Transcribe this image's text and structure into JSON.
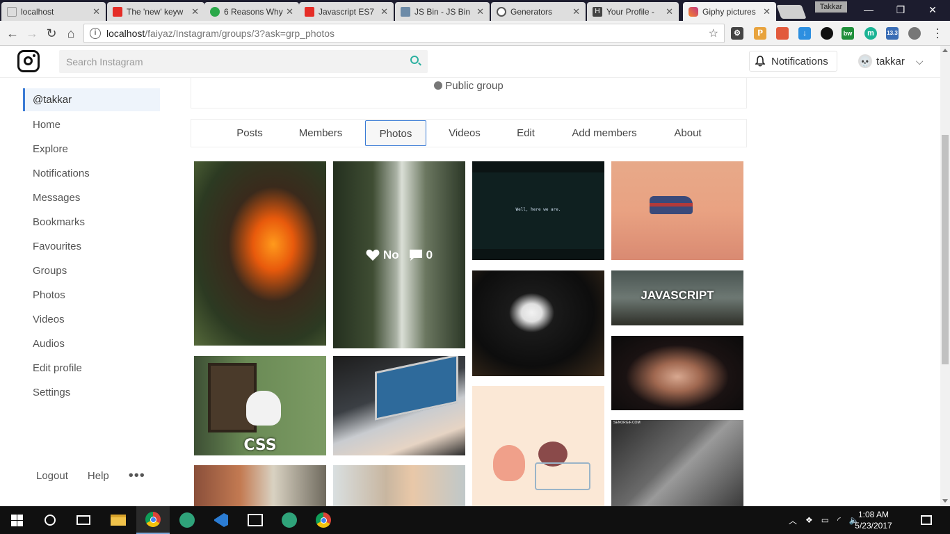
{
  "browser": {
    "tabs": [
      {
        "label": "localhost",
        "favicon_color": "#dddddd"
      },
      {
        "label": "The 'new' keyw",
        "favicon_color": "#e52d27"
      },
      {
        "label": "6 Reasons Why",
        "favicon_color": "#2ba84a"
      },
      {
        "label": "Javascript ES7",
        "favicon_color": "#e52d27"
      },
      {
        "label": "JS Bin - JS Bin",
        "favicon_color": "#6d8ba8"
      },
      {
        "label": "Generators",
        "favicon_color": "#555555"
      },
      {
        "label": "Your Profile - ",
        "favicon_color": "#444444"
      },
      {
        "label": "Giphy pictures",
        "favicon_color": "#c13584"
      }
    ],
    "profile_name": "Takkar",
    "window_controls": {
      "minimize": "—",
      "restore": "❐",
      "close": "✕"
    },
    "url_host": "localhost",
    "url_path": "/faiyaz/Instagram/groups/3?ask=grp_photos",
    "extension_badge": "13.3"
  },
  "header": {
    "search_placeholder": "Search Instagram",
    "notifications_label": "Notifications",
    "username": "takkar",
    "avatar_glyph": "💀"
  },
  "sidebar": {
    "items": [
      {
        "label": "@takkar"
      },
      {
        "label": "Home"
      },
      {
        "label": "Explore"
      },
      {
        "label": "Notifications"
      },
      {
        "label": "Messages"
      },
      {
        "label": "Bookmarks"
      },
      {
        "label": "Favourites"
      },
      {
        "label": "Groups"
      },
      {
        "label": "Photos"
      },
      {
        "label": "Videos"
      },
      {
        "label": "Audios"
      },
      {
        "label": "Edit profile"
      },
      {
        "label": "Settings"
      }
    ],
    "footer": {
      "logout": "Logout",
      "help": "Help",
      "more": "•••"
    }
  },
  "group": {
    "privacy": "Public group",
    "tabs": [
      {
        "label": "Posts"
      },
      {
        "label": "Members"
      },
      {
        "label": "Photos"
      },
      {
        "label": "Videos"
      },
      {
        "label": "Edit"
      },
      {
        "label": "Add members"
      },
      {
        "label": "About"
      }
    ],
    "active_tab": "Photos"
  },
  "photos": {
    "hover_overlay": {
      "likes": "No",
      "comments": "0"
    },
    "tile_texts": {
      "terminal": "Well, here we are.",
      "css": "CSS",
      "javascript": "JAVASCRIPT",
      "senorgif": "SENORGIF.COM"
    }
  },
  "taskbar": {
    "time": "1:08 AM",
    "date": "5/23/2017"
  }
}
